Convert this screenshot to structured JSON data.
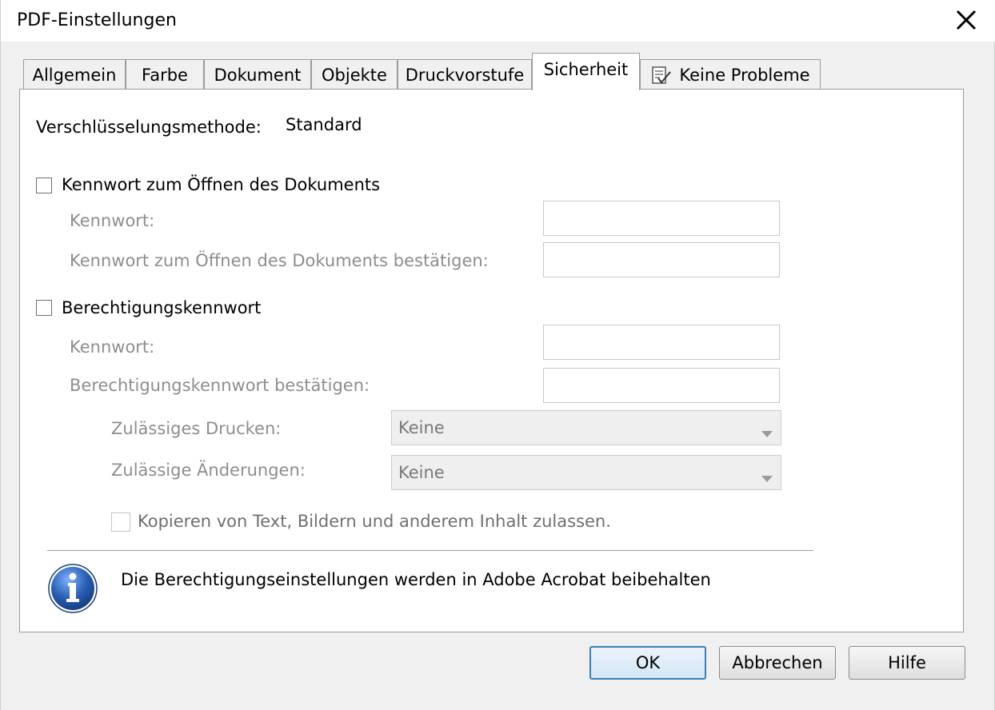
{
  "window": {
    "title": "PDF-Einstellungen"
  },
  "tabs": [
    {
      "label": "Allgemein",
      "active": false
    },
    {
      "label": "Farbe",
      "active": false
    },
    {
      "label": "Dokument",
      "active": false
    },
    {
      "label": "Objekte",
      "active": false
    },
    {
      "label": "Druckvorstufe",
      "active": false
    },
    {
      "label": "Sicherheit",
      "active": true
    },
    {
      "label": "Keine Probleme",
      "active": false,
      "icon": "checklist-icon"
    }
  ],
  "security": {
    "method_label": "Verschlüsselungsmethode:",
    "method_value": "Standard",
    "open_password": {
      "checkbox_label": "Kennwort zum Öffnen des Dokuments",
      "checked": false,
      "password_label": "Kennwort:",
      "password_value": "",
      "confirm_label": "Kennwort zum Öffnen des Dokuments bestätigen:",
      "confirm_value": ""
    },
    "permission_password": {
      "checkbox_label": "Berechtigungskennwort",
      "checked": false,
      "password_label": "Kennwort:",
      "password_value": "",
      "confirm_label": "Berechtigungskennwort bestätigen:",
      "confirm_value": "",
      "printing_label": "Zulässiges Drucken:",
      "printing_value": "Keine",
      "changes_label": "Zulässige Änderungen:",
      "changes_value": "Keine",
      "copy_label": "Kopieren von Text, Bildern und anderem Inhalt zulassen.",
      "copy_checked": false
    },
    "info_message": "Die Berechtigungseinstellungen werden in Adobe Acrobat beibehalten"
  },
  "buttons": {
    "ok": "OK",
    "cancel": "Abbrechen",
    "help": "Hilfe"
  },
  "colors": {
    "disabled_text": "#8d8d8d",
    "info_icon": "#2a5fb5",
    "default_button_border": "#3c7fb1"
  }
}
